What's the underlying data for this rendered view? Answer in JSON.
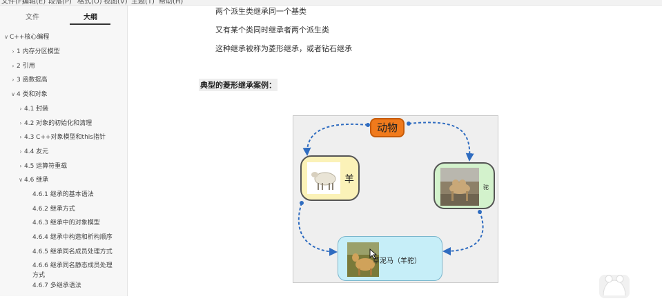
{
  "menubar": {
    "items": [
      "文件(F)",
      "编辑(E)",
      "段落(P)",
      "格式(O)",
      "视图(V)",
      "主题(T)",
      "帮助(H)"
    ]
  },
  "sidebar": {
    "tabs": [
      {
        "label": "文件",
        "active": false
      },
      {
        "label": "大纲",
        "active": true
      }
    ],
    "outline": [
      {
        "caret": "∨",
        "label": "C++核心编程"
      },
      {
        "caret": "›",
        "label": "1 内存分区模型"
      },
      {
        "caret": "›",
        "label": "2 引用"
      },
      {
        "caret": "›",
        "label": "3 函数提高"
      },
      {
        "caret": "∨",
        "label": "4 类和对象"
      },
      {
        "caret": "›",
        "label": "4.1 封装"
      },
      {
        "caret": "›",
        "label": "4.2 对象的初始化和清理"
      },
      {
        "caret": "›",
        "label": "4.3 C++对象模型和this指针"
      },
      {
        "caret": "›",
        "label": "4.4 友元"
      },
      {
        "caret": "›",
        "label": "4.5 运算符重载"
      },
      {
        "caret": "∨",
        "label": "4.6 继承"
      },
      {
        "caret": "",
        "label": "4.6.1 继承的基本语法"
      },
      {
        "caret": "",
        "label": "4.6.2 继承方式"
      },
      {
        "caret": "",
        "label": "4.6.3 继承中的对象模型"
      },
      {
        "caret": "",
        "label": "4.6.4 继承中构造和析构顺序"
      },
      {
        "caret": "",
        "label": "4.6.5 继承同名成员处理方式"
      },
      {
        "caret": "",
        "label": "4.6.6 继承同名静态成员处理"
      },
      {
        "caret": "",
        "label": "方式"
      },
      {
        "caret": "",
        "label": "4.6.7 多继承语法"
      }
    ]
  },
  "content": {
    "paragraphs": [
      "两个派生类继承同一个基类",
      "又有某个类同时继承者两个派生类",
      "这种继承被称为菱形继承，或者钻石继承"
    ],
    "heading": "典型的菱形继承案例："
  },
  "diagram": {
    "top_node": "动物",
    "left_node": "羊",
    "right_node": "驼",
    "bottom_node": "草泥马（羊驼）",
    "colors": {
      "top": "#f07a1c",
      "left": "#fbf2b8",
      "right": "#d3f2cc",
      "bottom": "#c6eef8",
      "arrow": "#2f6cc0"
    }
  }
}
